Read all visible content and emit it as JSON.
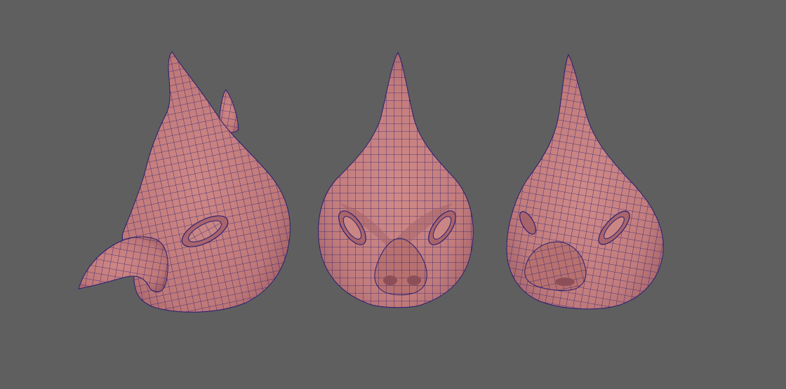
{
  "scene": {
    "background_color": "#5f5f5f",
    "surface_color": "#c27c7c",
    "surface_shadow_color": "#9b5c60",
    "wire_color": "#2a1f72",
    "models": [
      {
        "view": "side"
      },
      {
        "view": "front"
      },
      {
        "view": "three-quarter"
      }
    ]
  }
}
